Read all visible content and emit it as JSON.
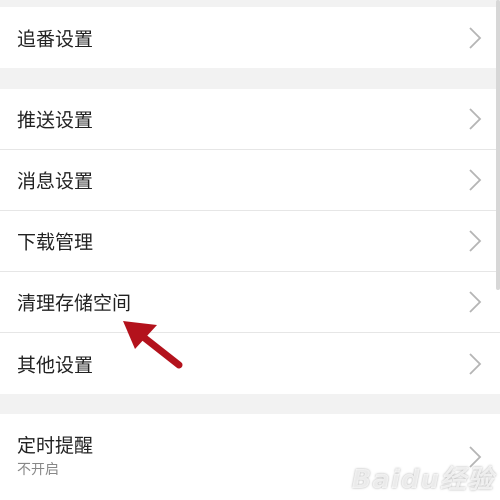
{
  "settings": {
    "group1": [
      {
        "label": "追番设置"
      }
    ],
    "group2": [
      {
        "label": "推送设置"
      },
      {
        "label": "消息设置"
      },
      {
        "label": "下载管理"
      },
      {
        "label": "清理存储空间"
      },
      {
        "label": "其他设置"
      }
    ],
    "group3": [
      {
        "label": "定时提醒",
        "sublabel": "不开启"
      }
    ]
  },
  "watermark": {
    "text": "Baidu经验"
  },
  "colors": {
    "background": "#f2f2f2",
    "card": "#ffffff",
    "text": "#222222",
    "subtext": "#888888",
    "chevron": "#b5b5b5",
    "annotation_arrow": "#b3121c"
  },
  "icons": {
    "row_chevron": "chevron-right-icon"
  }
}
